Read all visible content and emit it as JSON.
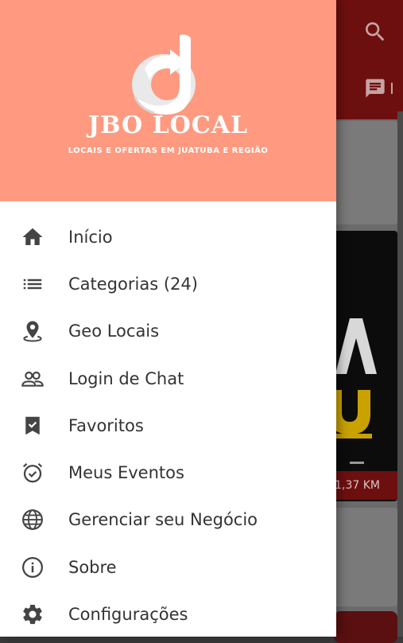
{
  "colors": {
    "drawer_header_bg": "#FF9A80",
    "toolbar_bg": "#6E0F0F",
    "icon_color": "#444444",
    "label_color": "#333333"
  },
  "header": {
    "brand_name": "JBO LOCAL",
    "tagline": "LOCAIS E OFERTAS EM JUATUBA E REGIÃO",
    "logo_icon": "jbo-logo-arrow"
  },
  "menu": {
    "items": [
      {
        "label": "Início",
        "icon": "home-icon"
      },
      {
        "label": "Categorias (24)",
        "icon": "list-icon"
      },
      {
        "label": "Geo Locais",
        "icon": "location-pin-icon"
      },
      {
        "label": "Login de Chat",
        "icon": "people-icon"
      },
      {
        "label": "Favoritos",
        "icon": "bookmark-check-icon"
      },
      {
        "label": "Meus Eventos",
        "icon": "alarm-check-icon"
      },
      {
        "label": "Gerenciar seu Negócio",
        "icon": "globe-icon"
      },
      {
        "label": "Sobre",
        "icon": "info-icon"
      },
      {
        "label": "Configurações",
        "icon": "gear-icon"
      }
    ]
  },
  "background": {
    "toolbar_icons": [
      "search-icon",
      "chat-icon"
    ],
    "card_distance": "1,37 KM"
  }
}
